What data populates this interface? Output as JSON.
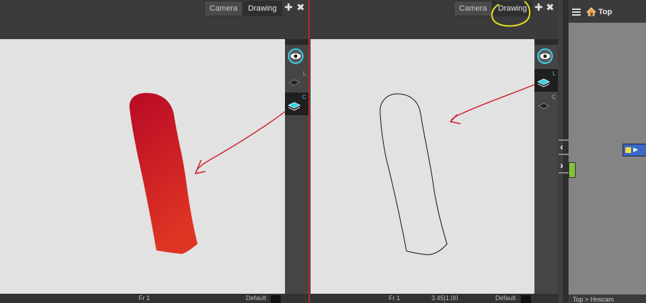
{
  "left_view": {
    "tabs": [
      {
        "label": "Camera",
        "active": false
      },
      {
        "label": "Drawing",
        "active": true
      }
    ],
    "layer_letters": [
      "L",
      "C"
    ],
    "status": {
      "frame": "Fr 1",
      "preset": "Default"
    }
  },
  "right_view": {
    "tabs": [
      {
        "label": "Camera",
        "active": false
      },
      {
        "label": "Drawing",
        "active": true
      }
    ],
    "layer_letters": [
      "L",
      "C"
    ],
    "status": {
      "frame": "Fr 1",
      "zoom": "3.45|1.00",
      "preset": "Default"
    }
  },
  "node_view": {
    "breadcrumb": "Top",
    "footer_path": "Top > Hnscam"
  },
  "colors": {
    "stroke_red": "#cc1e2a",
    "fill_top": "#b80a26",
    "fill_bottom": "#de3424",
    "highlight_circle": "#e3e023",
    "accent_cyan": "#3ad0e8"
  },
  "icons": [
    "add-icon",
    "close-icon",
    "eye-icon",
    "layer-icon",
    "menu-icon",
    "home-icon",
    "chevron-left-icon",
    "chevron-right-icon"
  ]
}
